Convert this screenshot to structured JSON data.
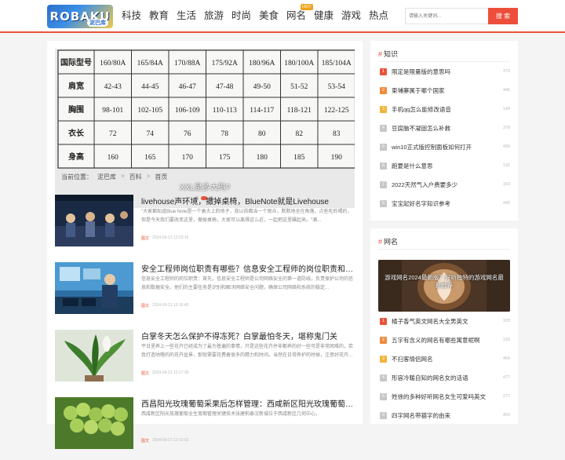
{
  "header": {
    "logo_text": "ROBAKU",
    "logo_sub": "泥巴库",
    "nav": [
      {
        "label": "科技"
      },
      {
        "label": "教育"
      },
      {
        "label": "生活"
      },
      {
        "label": "旅游"
      },
      {
        "label": "时尚"
      },
      {
        "label": "美食"
      },
      {
        "label": "网名",
        "badge": "HOT"
      },
      {
        "label": "健康"
      },
      {
        "label": "游戏"
      },
      {
        "label": "热点"
      }
    ],
    "search": {
      "placeholder": "请输入关键词...",
      "button_label": "搜 索"
    }
  },
  "banner": {
    "caption": "XXL是多大码?",
    "table": {
      "rows": [
        {
          "label": "国际型号",
          "values": [
            "160/80A",
            "165/84A",
            "170/88A",
            "175/92A",
            "180/96A",
            "180/100A",
            "185/104A"
          ]
        },
        {
          "label": "肩宽",
          "values": [
            "42-43",
            "44-45",
            "46-47",
            "47-48",
            "49-50",
            "51-52",
            "53-54"
          ]
        },
        {
          "label": "胸围",
          "values": [
            "98-101",
            "102-105",
            "106-109",
            "110-113",
            "114-117",
            "118-121",
            "122-125"
          ]
        },
        {
          "label": "衣长",
          "values": [
            "72",
            "74",
            "76",
            "78",
            "80",
            "82",
            "83"
          ]
        },
        {
          "label": "身高",
          "values": [
            "160",
            "165",
            "170",
            "175",
            "180",
            "185",
            "190"
          ]
        }
      ]
    }
  },
  "breadcrumb": {
    "prefix": "当前位置：",
    "items": [
      "泥巴库",
      "百科",
      "首页"
    ],
    "separator": ">"
  },
  "articles": [
    {
      "title": "livehouse声环境，撤掉桌椅，BlueNote就是Livehouse",
      "desc": "\"大家都知道Blue Note是一个高大上的场子，我以前都当一个观众，默默地坐在角落，点些吃的喝的，但是今天我们要改变这里，撤掉桌椅，大家可以离得这么近，一起把这里躁起来。\"满...",
      "category": "图文",
      "date": "2024-09-21 12:23:16"
    },
    {
      "title": "安全工程师岗位职责有哪些？信息安全工程师的岗位职责和工作内容",
      "desc": "信息安全工程师的岗位职责：首先，信息安全工程师是公司网络安全的第一道防线，负责保护公司的信息和数据安全。他们的主要任务是识别和解决网络安全问题，确保公司网络和系统的稳定...",
      "category": "图文",
      "date": "2024-09-21 12:16:40"
    },
    {
      "title": "白掌冬天怎么保护不得冻死？白掌最怕冬天，堪称鬼门关",
      "desc": "平日里养上一些花卉已经成为了最为普遍的事情，只是这些花卉并非都养的好一些可是非常困难的，若我打造咕噜的的花卉盆景，那就需要花费着很多的精力和时间。当然在日常养护的时候，注意好花卉...",
      "category": "图文",
      "date": "2024-09-21 12:17:30"
    },
    {
      "title": "西昌阳光玫瑰葡萄采果后怎样管理：西咸新区阳光玫瑰葡萄采收",
      "desc": "西咸新区阳光玫瑰葡萄全生育期管理关键技术张建莉泰汉新城位于西咸新区几何中心，",
      "category": "图文",
      "date": "2024-09-21 12:10:02"
    }
  ],
  "sidebar_zhishi": {
    "title": "知识",
    "items": [
      {
        "rank": "1",
        "title": "限定是限量版的意思吗",
        "count": "370"
      },
      {
        "rank": "2",
        "title": "柬埔寨属于哪个国家",
        "count": "446"
      },
      {
        "rank": "3",
        "title": "手机qq怎么能修改语音",
        "count": "149"
      },
      {
        "rank": "4",
        "title": "豆腐脑不凝固怎么补救",
        "count": "378"
      },
      {
        "rank": "5",
        "title": "win10正式版控制面板如何打开",
        "count": "459"
      },
      {
        "rank": "6",
        "title": "跑要是什么意思",
        "count": "132"
      },
      {
        "rank": "7",
        "title": "2022天然气入户费要多少",
        "count": "153"
      },
      {
        "rank": "8",
        "title": "宝宝起好名字知识参考",
        "count": "496"
      }
    ]
  },
  "sidebar_wangming": {
    "title": "网名",
    "banner_caption": "游戏网名2024最新版？好听独特的游戏网名最新推荐",
    "items": [
      {
        "rank": "1",
        "title": "橘子香气英文网名大全男英文",
        "count": "329"
      },
      {
        "rank": "2",
        "title": "五字有含义的网名有哪些寓意呢啊",
        "count": "193"
      },
      {
        "rank": "3",
        "title": "不扫客情侣网名",
        "count": "454"
      },
      {
        "rank": "4",
        "title": "形容冷暖自知的网名女的话语",
        "count": "477"
      },
      {
        "rank": "5",
        "title": "姓徐的多种好听网名女生可爱吗英文",
        "count": "277"
      },
      {
        "rank": "6",
        "title": "四字网名带猫字的由来",
        "count": "403"
      }
    ]
  },
  "colors": {
    "accent": "#e8533a",
    "rank1": "#e8533a",
    "rank2": "#f08a3e",
    "rank3": "#f3b43a",
    "rank_other": "#c8c8c8"
  }
}
